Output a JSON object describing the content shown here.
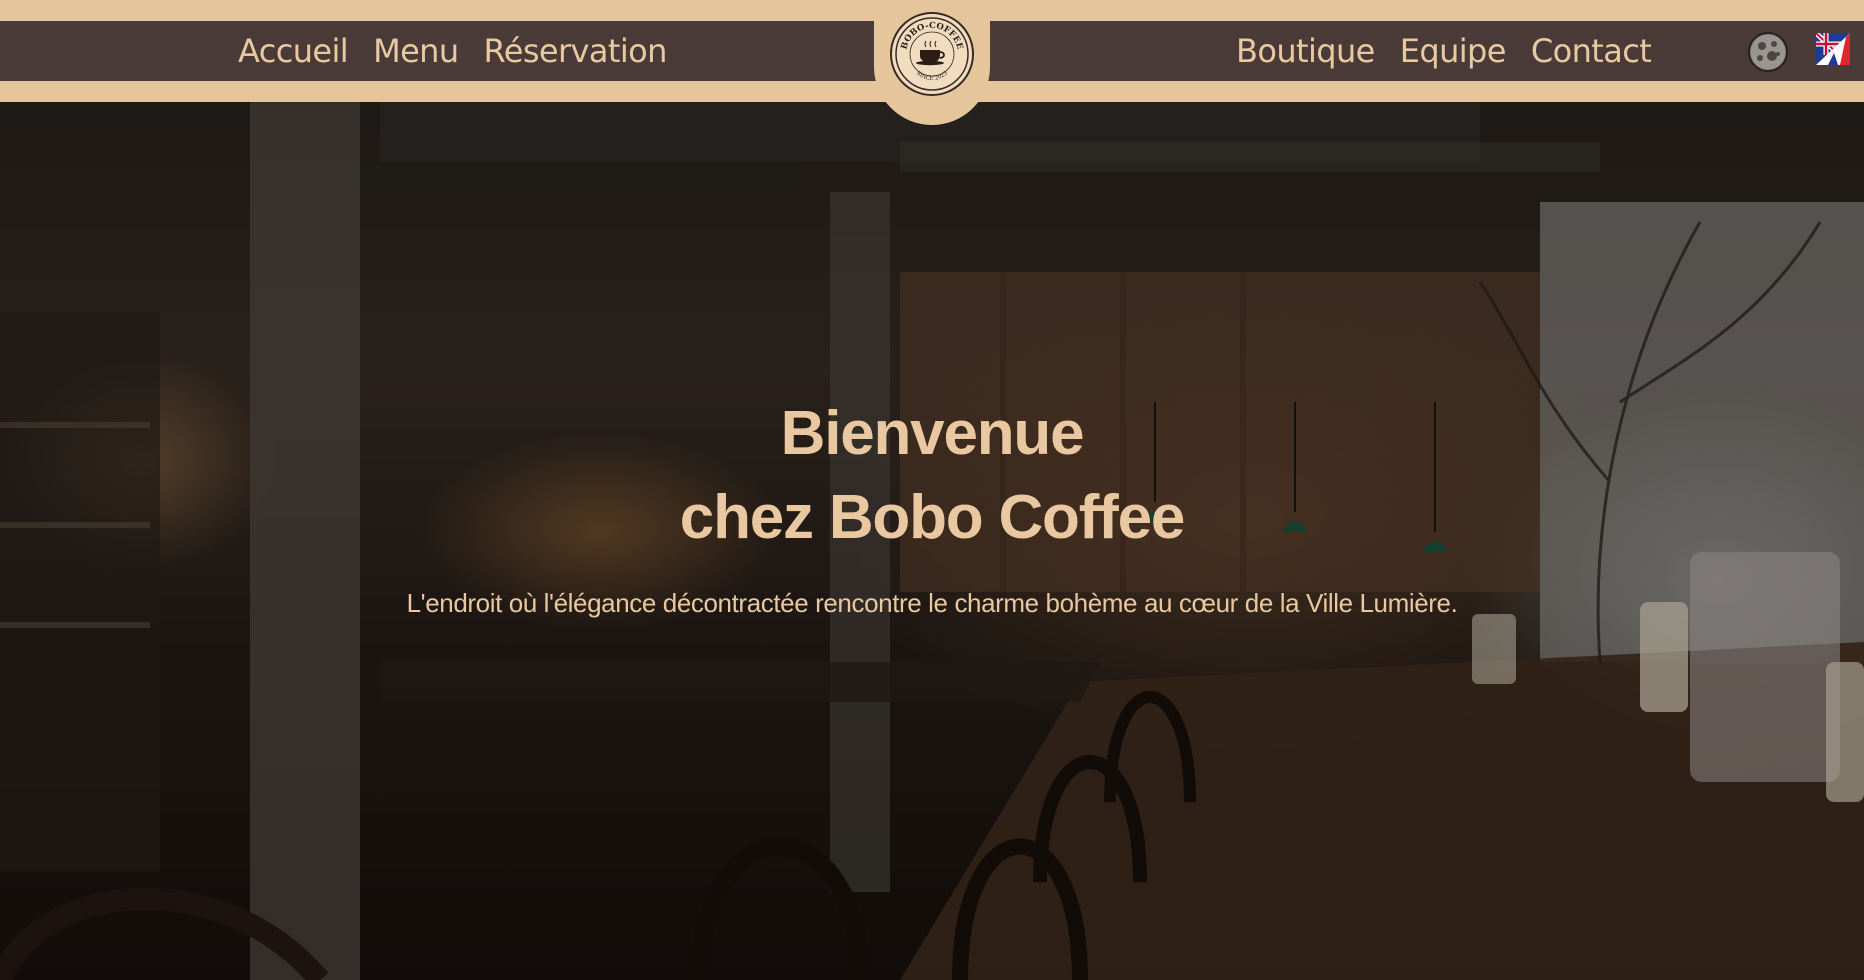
{
  "nav": {
    "left": [
      {
        "label": "Accueil"
      },
      {
        "label": "Menu"
      },
      {
        "label": "Réservation"
      }
    ],
    "right": [
      {
        "label": "Boutique"
      },
      {
        "label": "Equipe"
      },
      {
        "label": "Contact"
      }
    ]
  },
  "logo": {
    "brand_text": "BOBO-COFFEE",
    "since_text": "SINCE 2023"
  },
  "controls": {
    "theme_toggle_icon": "moon-icon",
    "language_icon": "uk-france-flag-icon"
  },
  "hero": {
    "title_line1": "Bienvenue",
    "title_line2": "chez Bobo Coffee",
    "subtitle": "L'endroit où l'élégance décontractée rencontre le charme bohème au cœur de la Ville Lumière."
  },
  "colors": {
    "header_bg": "#e5c69c",
    "nav_bar": "#4a3a38",
    "accent_text": "#e8c9a1"
  }
}
